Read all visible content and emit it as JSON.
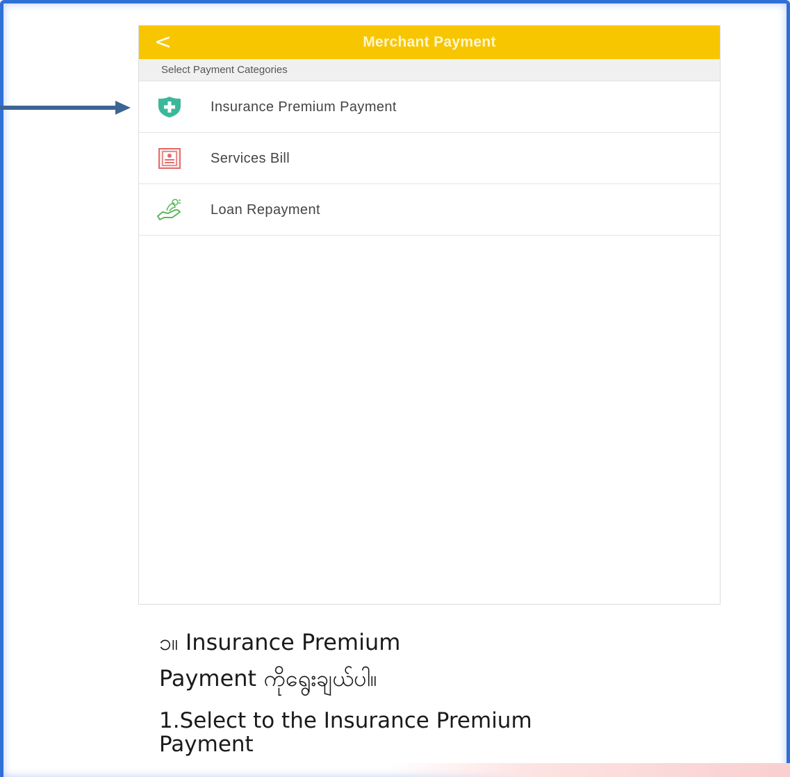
{
  "header": {
    "back_glyph": "<",
    "title": "Merchant Payment"
  },
  "section": {
    "label": "Select Payment Categories"
  },
  "categories": [
    {
      "label": "Insurance Premium Payment",
      "icon": "shield-plus-icon"
    },
    {
      "label": "Services Bill",
      "icon": "bill-document-icon"
    },
    {
      "label": "Loan Repayment",
      "icon": "hand-money-icon"
    }
  ],
  "instructions": {
    "my_line1": "၁။ Insurance Premium",
    "my_line2": "Payment ကိုရွေးချယ်ပါ။",
    "en_text": "1.Select to the Insurance Premium Payment"
  },
  "colors": {
    "header_bg": "#f7c600",
    "frame_border": "#2f6fd6",
    "arrow": "#3d6592",
    "shield": "#3bb89a",
    "bill": "#e36b6b",
    "loan": "#5bb65b"
  }
}
